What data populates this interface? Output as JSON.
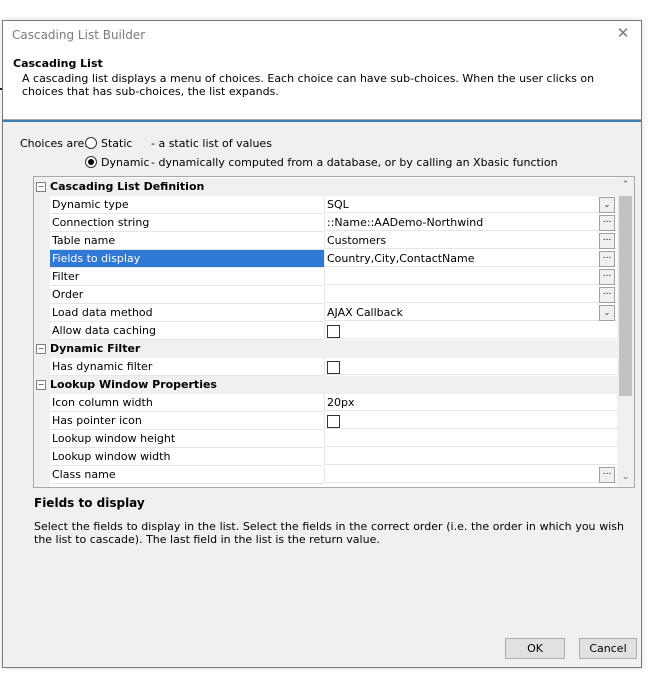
{
  "dialog": {
    "title": "Cascading List Builder",
    "close_glyph": "✕"
  },
  "header": {
    "title": "Cascading List",
    "description": "A cascading list displays a menu of choices. Each choice can have sub-choices. When the user clicks on choices that has sub-choices, the list expands."
  },
  "choices": {
    "label": "Choices are:",
    "options": [
      {
        "label": "Static",
        "description": "- a static list of values",
        "checked": false
      },
      {
        "label": "Dynamic",
        "description": "- dynamically computed from a database, or by calling an Xbasic function",
        "checked": true
      }
    ]
  },
  "grid": {
    "categories": [
      {
        "label": "Cascading List Definition",
        "expander": "⊟"
      },
      {
        "label": "Dynamic Filter",
        "expander": "⊟"
      },
      {
        "label": "Lookup Window Properties",
        "expander": "⊟"
      }
    ],
    "properties": [
      {
        "name": "Dynamic type",
        "value": "SQL",
        "editor": "combo"
      },
      {
        "name": "Connection string",
        "value": "::Name::AADemo-Northwind",
        "editor": "dots"
      },
      {
        "name": "Table name",
        "value": "Customers",
        "editor": "dots"
      },
      {
        "name": "Fields to display",
        "value": "Country,City,ContactName",
        "editor": "dots",
        "selected": true
      },
      {
        "name": "Filter",
        "value": "",
        "editor": "dots"
      },
      {
        "name": "Order",
        "value": "",
        "editor": "dots"
      },
      {
        "name": "Load data method",
        "value": "AJAX Callback",
        "editor": "combo"
      },
      {
        "name": "Allow data caching",
        "value": "",
        "editor": "checkbox"
      },
      {
        "name": "Has dynamic filter",
        "value": "",
        "editor": "checkbox"
      },
      {
        "name": "Icon column width",
        "value": "20px",
        "editor": "none"
      },
      {
        "name": "Has pointer icon",
        "value": "",
        "editor": "checkbox"
      },
      {
        "name": "Lookup window height",
        "value": "",
        "editor": "none"
      },
      {
        "name": "Lookup window width",
        "value": "",
        "editor": "none"
      },
      {
        "name": "Class name",
        "value": "",
        "editor": "dots"
      }
    ],
    "dots_glyph": "...",
    "combo_glyph": "⌄",
    "scroll_up": "⌃",
    "scroll_down": "⌄"
  },
  "help": {
    "title": "Fields to display",
    "text": "Select the fields to display in the list. Select the fields in the correct order (i.e. the order in which you wish the list to cascade). The last field in the list is the return value."
  },
  "buttons": {
    "ok": "OK",
    "cancel": "Cancel"
  },
  "colors": {
    "accent_rule": "#3c7fb1",
    "selection": "#3078d6"
  }
}
